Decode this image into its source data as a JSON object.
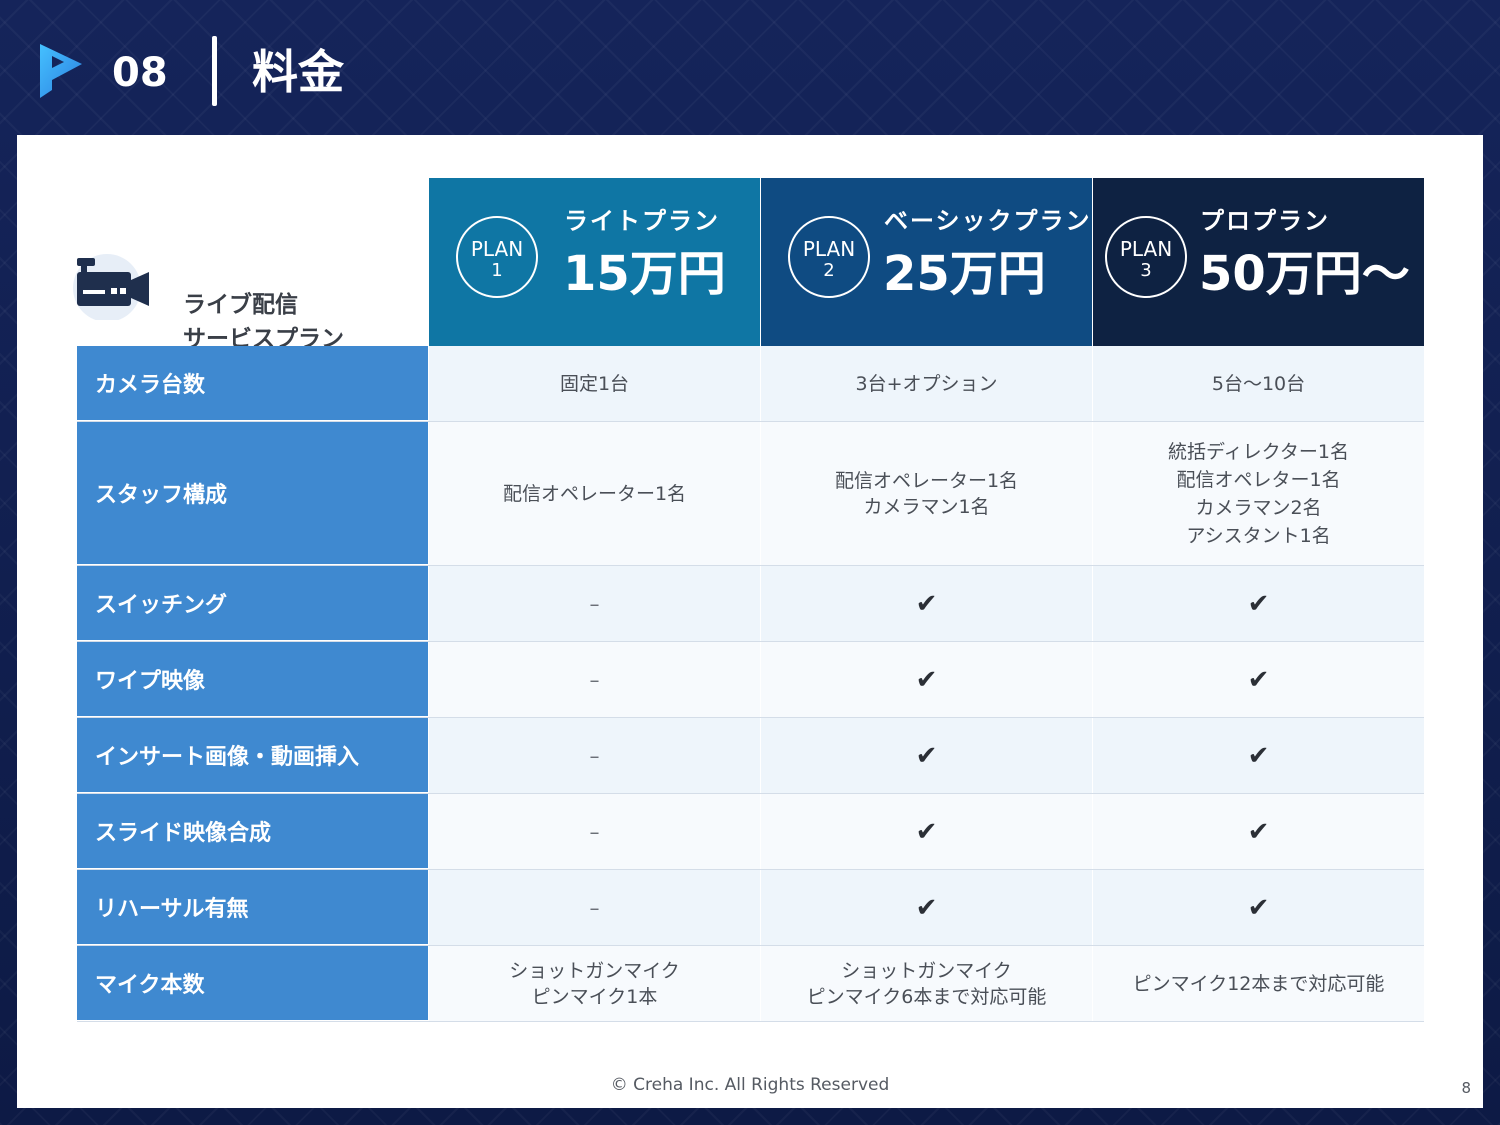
{
  "header": {
    "section_number": "08",
    "section_title": "料金"
  },
  "corner": {
    "title_line1": "ライブ配信",
    "title_line2": "サービスプラン",
    "icon": "video-camera-icon"
  },
  "plans": [
    {
      "badge": "PLAN",
      "number": "1",
      "name": "ライトプラン",
      "price": "15万円",
      "color": "#0f76a4"
    },
    {
      "badge": "PLAN",
      "number": "2",
      "name": "ベーシックプラン",
      "price": "25万円",
      "color": "#0f4b82"
    },
    {
      "badge": "PLAN",
      "number": "3",
      "name": "プロプラン",
      "price": "50万円〜",
      "color": "#0e2242"
    }
  ],
  "rows": [
    {
      "label": "カメラ台数",
      "cells": [
        [
          "固定1台"
        ],
        [
          "3台+オプション"
        ],
        [
          "5台〜10台"
        ]
      ]
    },
    {
      "label": "スタッフ構成",
      "cells": [
        [
          "配信オペレーター1名"
        ],
        [
          "配信オペレーター1名",
          "カメラマン1名"
        ],
        [
          "統括ディレクター1名",
          "配信オペレター1名",
          "カメラマン2名",
          "アシスタント1名"
        ]
      ]
    },
    {
      "label": "スイッチング",
      "cells": [
        [
          "–"
        ],
        [
          "✔"
        ],
        [
          "✔"
        ]
      ]
    },
    {
      "label": "ワイプ映像",
      "cells": [
        [
          "–"
        ],
        [
          "✔"
        ],
        [
          "✔"
        ]
      ]
    },
    {
      "label": "インサート画像・動画挿入",
      "cells": [
        [
          "–"
        ],
        [
          "✔"
        ],
        [
          "✔"
        ]
      ]
    },
    {
      "label": "スライド映像合成",
      "cells": [
        [
          "–"
        ],
        [
          "✔"
        ],
        [
          "✔"
        ]
      ]
    },
    {
      "label": "リハーサル有無",
      "cells": [
        [
          "–"
        ],
        [
          "✔"
        ],
        [
          "✔"
        ]
      ]
    },
    {
      "label": "マイク本数",
      "cells": [
        [
          "ショットガンマイク",
          "ピンマイク1本"
        ],
        [
          "ショットガンマイク",
          "ピンマイク6本まで対応可能"
        ],
        [
          "ピンマイク12本まで対応可能"
        ]
      ]
    }
  ],
  "footer": {
    "copyright": "© Creha Inc. All Rights Reserved",
    "page_number": "8"
  },
  "colors": {
    "accent_blue": "#3f89d0",
    "background_navy": "#0f1d4a"
  }
}
